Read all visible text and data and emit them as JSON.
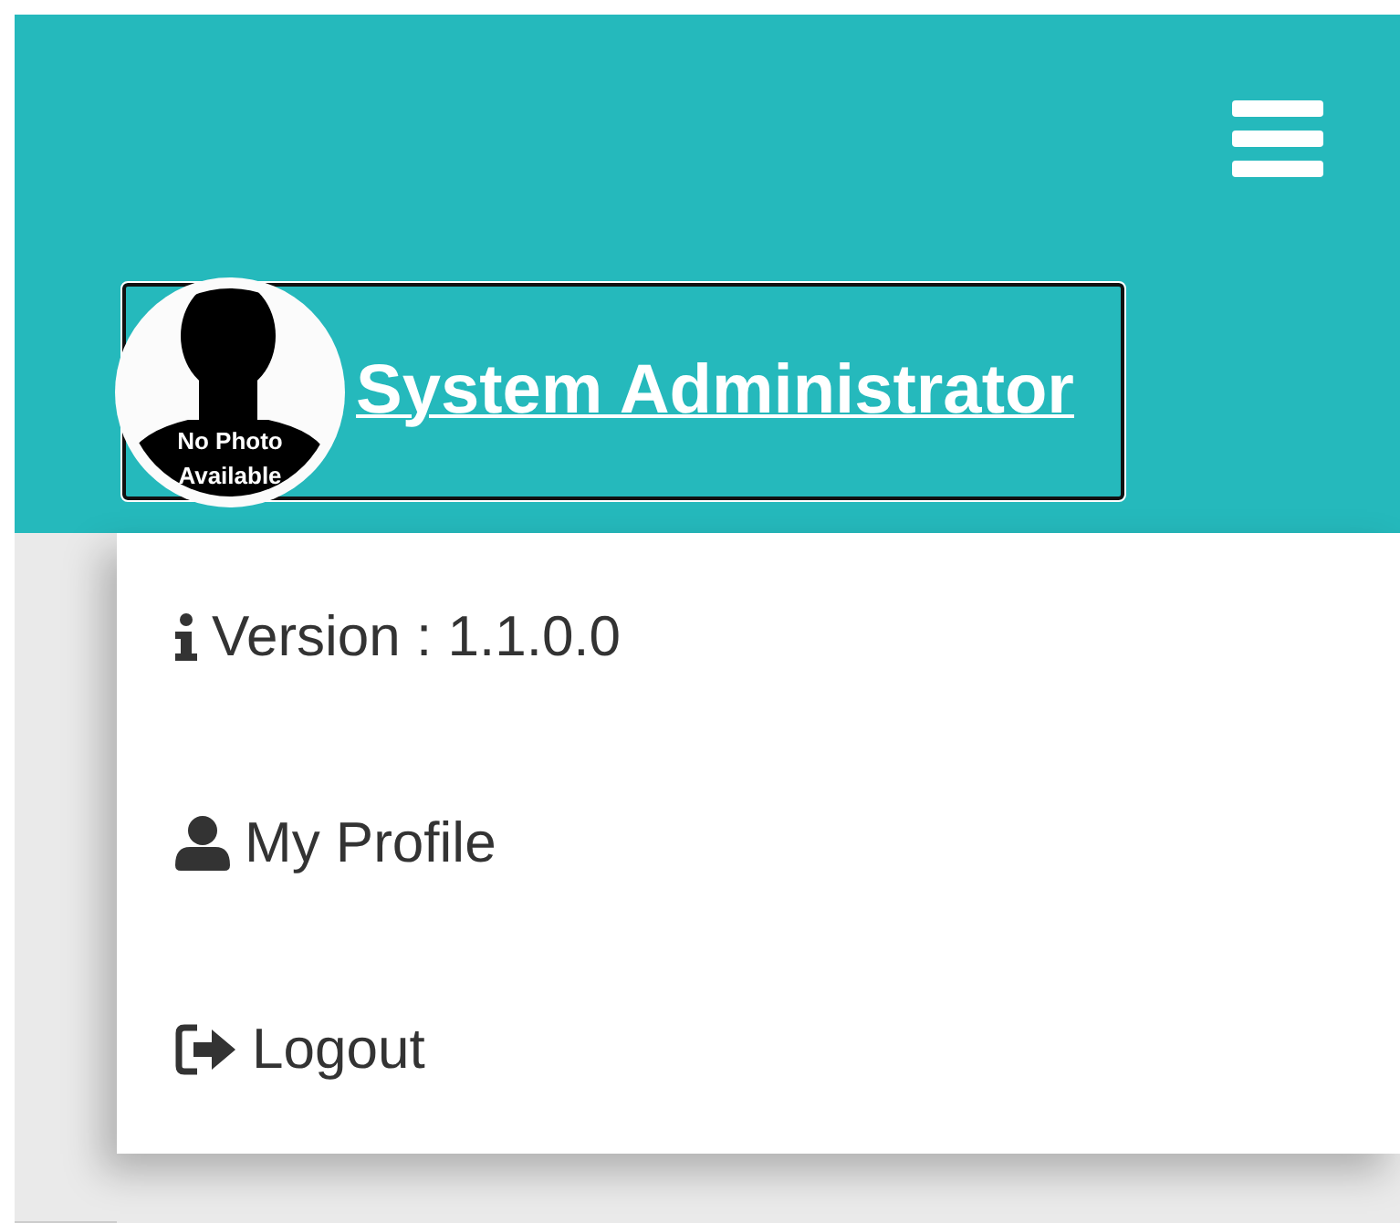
{
  "header": {
    "user_name": "System Administrator",
    "avatar_caption": [
      "No Photo",
      "Available"
    ]
  },
  "menu": [
    {
      "kind": "info",
      "label": "Version : 1.1.0.0"
    },
    {
      "kind": "profile",
      "label": "My Profile"
    },
    {
      "kind": "logout",
      "label": "Logout"
    }
  ]
}
